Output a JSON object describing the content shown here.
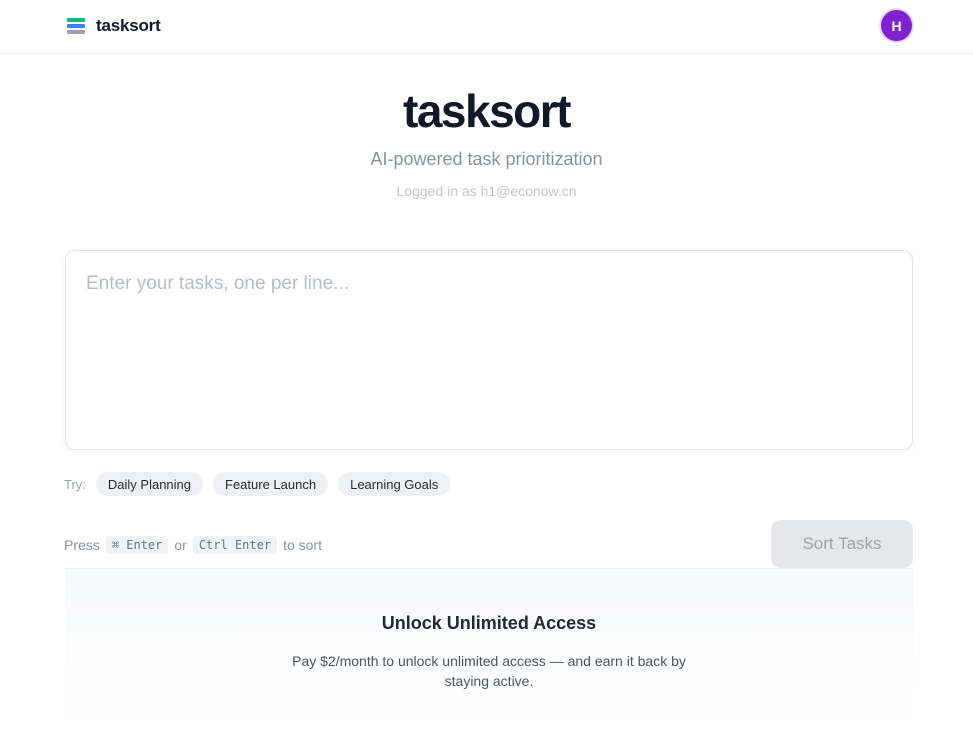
{
  "header": {
    "brand_name": "tasksort",
    "brand_icon": "stacked-layers-icon",
    "avatar_initial": "H",
    "avatar_color": "#7e22ce"
  },
  "hero": {
    "title": "tasksort",
    "subtitle": "AI-powered task prioritization",
    "login_text": "Logged in as h1@econow.cn"
  },
  "task_input": {
    "placeholder": "Enter your tasks, one per line...",
    "value": ""
  },
  "try": {
    "label": "Try:",
    "chips": [
      "Daily Planning",
      "Feature Launch",
      "Learning Goals"
    ]
  },
  "hint": {
    "press": "Press",
    "mac_shortcut": "⌘ Enter",
    "or": "or",
    "win_shortcut": "Ctrl Enter",
    "suffix": "to sort"
  },
  "sort_button": {
    "label": "Sort Tasks",
    "disabled": true
  },
  "unlock": {
    "title": "Unlock Unlimited Access",
    "text": "Pay $2/month to unlock unlimited access — and earn it back by staying active."
  },
  "colors": {
    "accent": "#7e22ce",
    "icon_green": "#10b981",
    "icon_blue": "#3b82f6",
    "icon_gray": "#9ca3af"
  }
}
